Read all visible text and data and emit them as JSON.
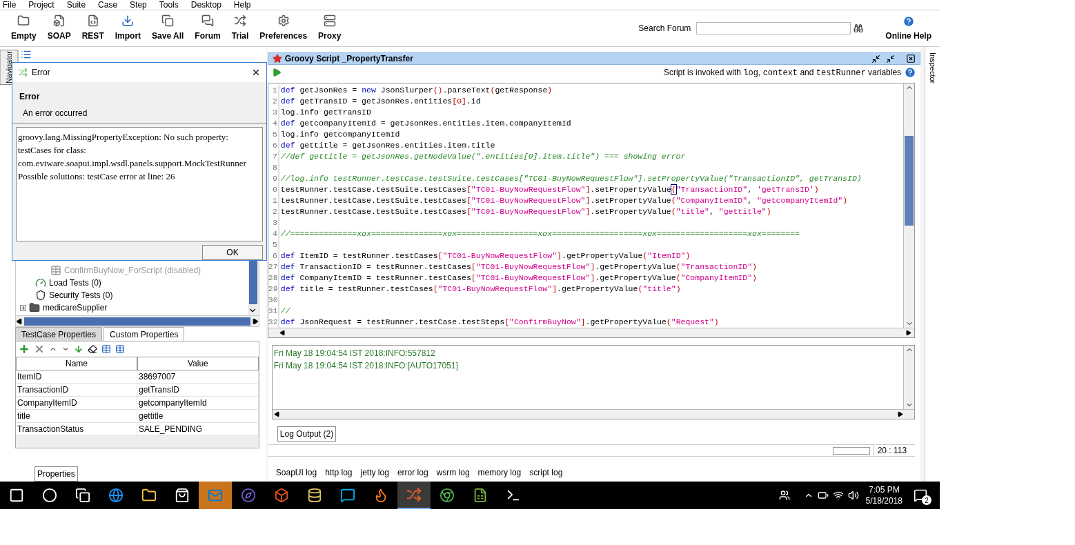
{
  "menu": [
    "File",
    "Project",
    "Suite",
    "Case",
    "Step",
    "Tools",
    "Desktop",
    "Help"
  ],
  "toolbar": [
    "Empty",
    "SOAP",
    "REST",
    "Import",
    "Save All",
    "Forum",
    "Trial",
    "Preferences",
    "Proxy"
  ],
  "search": {
    "label": "Search Forum"
  },
  "online_help": "Online Help",
  "navigator_tab": "Navigator",
  "inspector_tab": "Inspector",
  "tree": [
    {
      "children": [
        {
          "children": [
            {
              "label": "ConfirmBuyNow_ForScript (disabled)",
              "disabled": true
            }
          ]
        },
        {
          "label": "Load Tests (0)",
          "disabled": false
        },
        {
          "label": "Security Tests (0)",
          "disabled": false
        }
      ]
    },
    {
      "label": "medicareSupplier",
      "disabled": false,
      "expanded": false
    }
  ],
  "dialog": {
    "title": "Error",
    "heading": "Error",
    "subheading": "An error occurred",
    "message": [
      "groovy.lang.MissingPropertyException: No such property:",
      "testCases for class:",
      "com.eviware.soapui.impl.wsdl.panels.support.MockTestRunner",
      "Possible solutions: testCase error at line: 26"
    ],
    "ok": "OK"
  },
  "property_tabs": [
    {
      "label": "TestCase Properties",
      "selected": false
    },
    {
      "label": "Custom Properties",
      "selected": true
    }
  ],
  "properties": {
    "columns": [
      "Name",
      "Value"
    ],
    "rows": [
      [
        "ItemID",
        "38697007"
      ],
      [
        "TransactionID",
        "getTransID"
      ],
      [
        "CompanyItemID",
        "getcompanyItemId"
      ],
      [
        "title",
        "gettitle"
      ],
      [
        "TransactionStatus",
        "SALE_PENDING"
      ]
    ]
  },
  "properties_button": "Properties",
  "editor": {
    "title": "Groovy Script _PropertyTransfer",
    "hint": [
      {
        "kind": "text",
        "text": "Script is invoked with "
      },
      {
        "kind": "code",
        "text": "log"
      },
      {
        "kind": "text",
        "text": ", "
      },
      {
        "kind": "code",
        "text": "context"
      },
      {
        "kind": "text",
        "text": " and "
      },
      {
        "kind": "code",
        "text": "testRunner"
      },
      {
        "kind": "text",
        "text": " variables"
      }
    ],
    "lines": [
      {
        "number": "1",
        "tokens": [
          {
            "kind": "kw",
            "text": "def"
          },
          {
            "kind": "txt",
            "text": " getJsonRes = "
          },
          {
            "kind": "kw",
            "text": "new"
          },
          {
            "kind": "txt",
            "text": " JsonSlurper"
          },
          {
            "kind": "op",
            "text": "()"
          },
          {
            "kind": "txt",
            "text": ".parseText"
          },
          {
            "kind": "op",
            "text": "("
          },
          {
            "kind": "txt",
            "text": "getResponse"
          },
          {
            "kind": "op",
            "text": ")"
          }
        ]
      },
      {
        "number": "2",
        "tokens": [
          {
            "kind": "kw",
            "text": "def"
          },
          {
            "kind": "txt",
            "text": " getTransID = getJsonRes.entities"
          },
          {
            "kind": "op",
            "text": "[0]"
          },
          {
            "kind": "txt",
            "text": ".id"
          }
        ]
      },
      {
        "number": "3",
        "tokens": [
          {
            "kind": "txt",
            "text": "log.info getTransID"
          }
        ]
      },
      {
        "number": "4",
        "tokens": [
          {
            "kind": "kw",
            "text": "def"
          },
          {
            "kind": "txt",
            "text": " getcompanyItemId = getJsonRes.entities.item.companyItemId"
          }
        ]
      },
      {
        "number": "5",
        "tokens": [
          {
            "kind": "txt",
            "text": "log.info getcompanyItemId"
          }
        ]
      },
      {
        "number": "6",
        "tokens": [
          {
            "kind": "kw",
            "text": "def"
          },
          {
            "kind": "txt",
            "text": " gettitle = getJsonRes.entities.item.title"
          }
        ]
      },
      {
        "number": "7",
        "tokens": [
          {
            "kind": "cmt",
            "text": "//def gettitle = getJsonRes.getNodeValue(\".entities[0].item.title\") === showing error"
          }
        ]
      },
      {
        "number": "8"
      },
      {
        "number": "9",
        "tokens": [
          {
            "kind": "cmt",
            "text": "//log.info testRunner.testCase.testSuite.testCases[\"TC01-BuyNowRequestFlow\"].setPropertyValue(\"TransactionID\", getTransID)"
          }
        ]
      },
      {
        "number": "0",
        "tokens": [
          {
            "kind": "txt",
            "text": "testRunner.testCase.testSuite.testCases"
          },
          {
            "kind": "op",
            "text": "["
          },
          {
            "kind": "str",
            "text": "\"TC01-BuyNowRequestFlow\""
          },
          {
            "kind": "op",
            "text": "]"
          },
          {
            "kind": "txt",
            "text": ".setPropertyValue"
          },
          {
            "kind": "caret",
            "text": "("
          },
          {
            "kind": "str",
            "text": "\"TransactionID\""
          },
          {
            "kind": "txt",
            "text": ", "
          },
          {
            "kind": "str",
            "text": "'getTransID'"
          },
          {
            "kind": "op",
            "text": ")"
          }
        ]
      },
      {
        "number": "1",
        "tokens": [
          {
            "kind": "txt",
            "text": "testRunner.testCase.testSuite.testCases"
          },
          {
            "kind": "op",
            "text": "["
          },
          {
            "kind": "str",
            "text": "\"TC01-BuyNowRequestFlow\""
          },
          {
            "kind": "op",
            "text": "]"
          },
          {
            "kind": "txt",
            "text": ".setPropertyValue"
          },
          {
            "kind": "op",
            "text": "("
          },
          {
            "kind": "str",
            "text": "\"CompanyItemID\""
          },
          {
            "kind": "txt",
            "text": ", "
          },
          {
            "kind": "str",
            "text": "\"getcompanyItemId\""
          },
          {
            "kind": "op",
            "text": ")"
          }
        ]
      },
      {
        "number": "2",
        "tokens": [
          {
            "kind": "txt",
            "text": "testRunner.testCase.testSuite.testCases"
          },
          {
            "kind": "op",
            "text": "["
          },
          {
            "kind": "str",
            "text": "\"TC01-BuyNowRequestFlow\""
          },
          {
            "kind": "op",
            "text": "]"
          },
          {
            "kind": "txt",
            "text": ".setPropertyValue"
          },
          {
            "kind": "op",
            "text": "("
          },
          {
            "kind": "str",
            "text": "\"title\""
          },
          {
            "kind": "txt",
            "text": ", "
          },
          {
            "kind": "str",
            "text": "\"gettitle\""
          },
          {
            "kind": "op",
            "text": ")"
          }
        ]
      },
      {
        "number": "3"
      },
      {
        "number": "4",
        "tokens": [
          {
            "kind": "cmt",
            "text": "//==============xox===============xox=================xox===================xox===================xox========"
          }
        ]
      },
      {
        "number": "5"
      },
      {
        "number": "6",
        "tokens": [
          {
            "kind": "kw",
            "text": "def"
          },
          {
            "kind": "txt",
            "text": " ItemID = testRunner.testCases"
          },
          {
            "kind": "op",
            "text": "["
          },
          {
            "kind": "str",
            "text": "\"TC01-BuyNowRequestFlow\""
          },
          {
            "kind": "op",
            "text": "]"
          },
          {
            "kind": "txt",
            "text": ".getPropertyValue"
          },
          {
            "kind": "op",
            "text": "("
          },
          {
            "kind": "str",
            "text": "\"ItemID\""
          },
          {
            "kind": "op",
            "text": ")"
          }
        ]
      },
      {
        "number": "27",
        "tokens": [
          {
            "kind": "kw",
            "text": "def"
          },
          {
            "kind": "txt",
            "text": " TransactionID = testRunner.testCases"
          },
          {
            "kind": "op",
            "text": "["
          },
          {
            "kind": "str",
            "text": "\"TC01-BuyNowRequestFlow\""
          },
          {
            "kind": "op",
            "text": "]"
          },
          {
            "kind": "txt",
            "text": ".getPropertyValue"
          },
          {
            "kind": "op",
            "text": "("
          },
          {
            "kind": "str",
            "text": "\"TransactionID\""
          },
          {
            "kind": "op",
            "text": ")"
          }
        ]
      },
      {
        "number": "28",
        "tokens": [
          {
            "kind": "kw",
            "text": "def"
          },
          {
            "kind": "txt",
            "text": " CompanyItemID = testRunner.testCases"
          },
          {
            "kind": "op",
            "text": "["
          },
          {
            "kind": "str",
            "text": "\"TC01-BuyNowRequestFlow\""
          },
          {
            "kind": "op",
            "text": "]"
          },
          {
            "kind": "txt",
            "text": ".getPropertyValue"
          },
          {
            "kind": "op",
            "text": "("
          },
          {
            "kind": "str",
            "text": "\"CompanyItemID\""
          },
          {
            "kind": "op",
            "text": ")"
          }
        ]
      },
      {
        "number": "29",
        "tokens": [
          {
            "kind": "kw",
            "text": "def"
          },
          {
            "kind": "txt",
            "text": " title = testRunner.testCases"
          },
          {
            "kind": "op",
            "text": "["
          },
          {
            "kind": "str",
            "text": "\"TC01-BuyNowRequestFlow\""
          },
          {
            "kind": "op",
            "text": "]"
          },
          {
            "kind": "txt",
            "text": ".getPropertyValue"
          },
          {
            "kind": "op",
            "text": "("
          },
          {
            "kind": "str",
            "text": "\"title\""
          },
          {
            "kind": "op",
            "text": ")"
          }
        ]
      },
      {
        "number": "30"
      },
      {
        "number": "31",
        "tokens": [
          {
            "kind": "cmt",
            "text": "//"
          }
        ]
      },
      {
        "number": "32",
        "tokens": [
          {
            "kind": "kw",
            "text": "def"
          },
          {
            "kind": "txt",
            "text": " JsonRequest = testRunner.testCase.testSteps"
          },
          {
            "kind": "op",
            "text": "["
          },
          {
            "kind": "str",
            "text": "\"ConfirmBuyNow\""
          },
          {
            "kind": "op",
            "text": "]"
          },
          {
            "kind": "txt",
            "text": ".getPropertyValue"
          },
          {
            "kind": "op",
            "text": "("
          },
          {
            "kind": "str",
            "text": "\"Request\""
          },
          {
            "kind": "op",
            "text": ")"
          }
        ]
      }
    ]
  },
  "log": [
    "Fri May 18 19:04:54 IST 2018:INFO:557812",
    "Fri May 18 19:04:54 IST 2018:INFO:[AUTO17051]"
  ],
  "log_output_button": "Log Output (2)",
  "cursor_position": "20 : 113",
  "log_tabs": [
    "SoapUI log",
    "http log",
    "jetty log",
    "error log",
    "wsrm log",
    "memory log",
    "script log"
  ],
  "taskbar": {
    "apps": [
      {
        "selected": false,
        "flashing": false
      },
      {
        "selected": false,
        "flashing": false
      },
      {
        "selected": false,
        "flashing": false
      },
      {
        "selected": false,
        "flashing": false
      },
      {
        "selected": false,
        "flashing": false
      },
      {
        "selected": false,
        "flashing": false
      },
      {
        "selected": false,
        "flashing": true
      },
      {
        "selected": false,
        "flashing": false
      },
      {
        "selected": false,
        "flashing": false
      },
      {
        "selected": false,
        "flashing": false
      },
      {
        "selected": false,
        "flashing": false
      },
      {
        "selected": false,
        "flashing": false
      },
      {
        "selected": true,
        "flashing": false
      },
      {
        "selected": false,
        "flashing": false
      },
      {
        "selected": false,
        "flashing": false
      },
      {
        "selected": false,
        "flashing": false
      }
    ],
    "time": "7:05 PM",
    "date": "5/18/2018",
    "notifications": "2"
  }
}
